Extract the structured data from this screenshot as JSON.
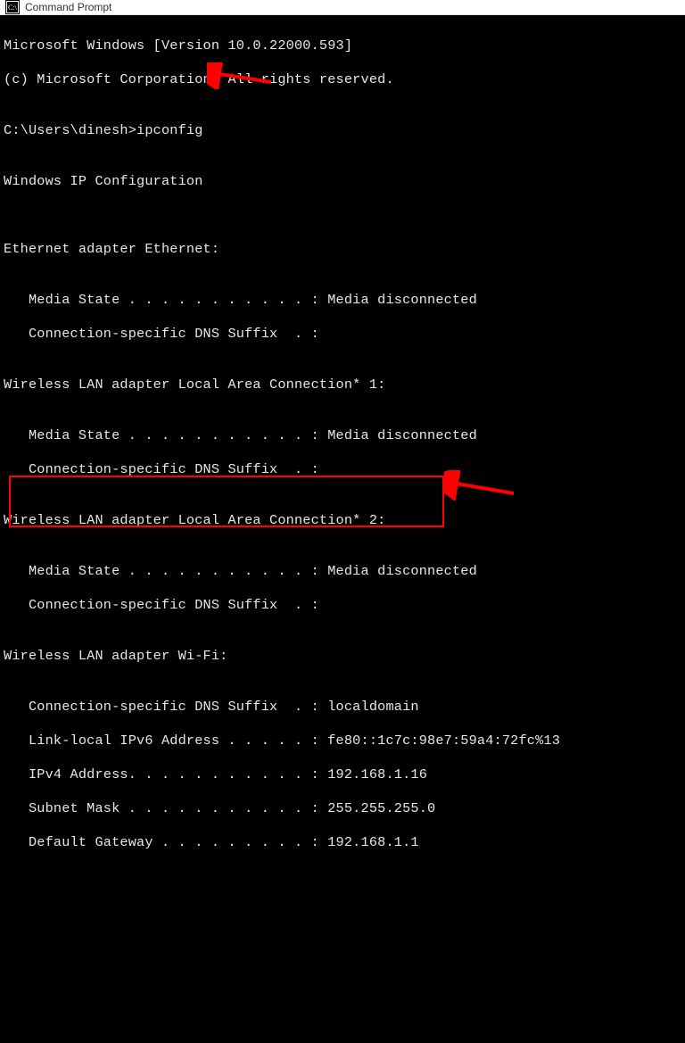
{
  "titlebar": {
    "title": "Command Prompt"
  },
  "terminal": {
    "header1": "Microsoft Windows [Version 10.0.22000.593]",
    "header2": "(c) Microsoft Corporation. All rights reserved.",
    "blank": "",
    "prompt_line": "C:\\Users\\dinesh>ipconfig",
    "section_winip": "Windows IP Configuration",
    "section_eth": "Ethernet adapter Ethernet:",
    "eth_media": "   Media State . . . . . . . . . . . : Media disconnected",
    "eth_dns": "   Connection-specific DNS Suffix  . :",
    "section_wlan1": "Wireless LAN adapter Local Area Connection* 1:",
    "wlan1_media": "   Media State . . . . . . . . . . . : Media disconnected",
    "wlan1_dns": "   Connection-specific DNS Suffix  . :",
    "section_wlan2": "Wireless LAN adapter Local Area Connection* 2:",
    "wlan2_media": "   Media State . . . . . . . . . . . : Media disconnected",
    "wlan2_dns": "   Connection-specific DNS Suffix  . :",
    "section_wifi": "Wireless LAN adapter Wi-Fi:",
    "wifi_dns": "   Connection-specific DNS Suffix  . : localdomain",
    "wifi_ipv6": "   Link-local IPv6 Address . . . . . : fe80::1c7c:98e7:59a4:72fc%13",
    "wifi_ipv4": "   IPv4 Address. . . . . . . . . . . : 192.168.1.16",
    "wifi_mask": "   Subnet Mask . . . . . . . . . . . : 255.255.255.0",
    "wifi_gw": "   Default Gateway . . . . . . . . . : 192.168.1.1"
  },
  "annotations": {
    "arrow_color": "#ff0000",
    "box_color": "#ff0000"
  }
}
